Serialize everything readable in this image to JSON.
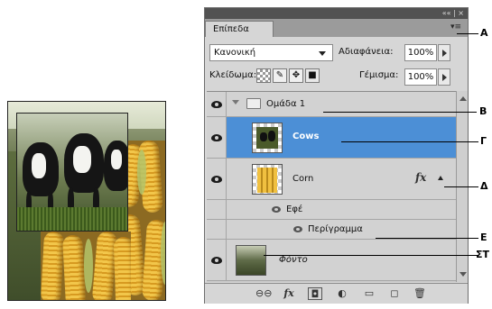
{
  "panel": {
    "tab_label": "Επίπεδα",
    "titlebar_controls": "«« | ×",
    "menu_icon": "panel-menu-icon",
    "blend_mode": "Κανονική",
    "opacity_label": "Αδιαφάνεια:",
    "opacity_value": "100%",
    "lock_label": "Κλείδωμα:",
    "fill_label": "Γέμισμα:",
    "fill_value": "100%"
  },
  "layers": {
    "group_name": "Ομάδα 1",
    "cows_name": "Cows",
    "corn_name": "Corn",
    "corn_fx": "fx",
    "effects_label": "Εφέ",
    "stroke_label": "Περίγραμμα",
    "background_name": "Φόντο"
  },
  "bottom_icons": [
    "link-icon",
    "fx-icon",
    "mask-icon",
    "adjustment-icon",
    "new-group-icon",
    "new-layer-icon",
    "trash-icon"
  ],
  "callouts": {
    "a": "A",
    "b": "B",
    "g": "Γ",
    "d": "Δ",
    "e": "Ε",
    "st": "ΣΤ"
  },
  "colors": {
    "selection": "#4c8fd6",
    "panel_bg": "#d6d6d6",
    "titlebar": "#525252"
  }
}
